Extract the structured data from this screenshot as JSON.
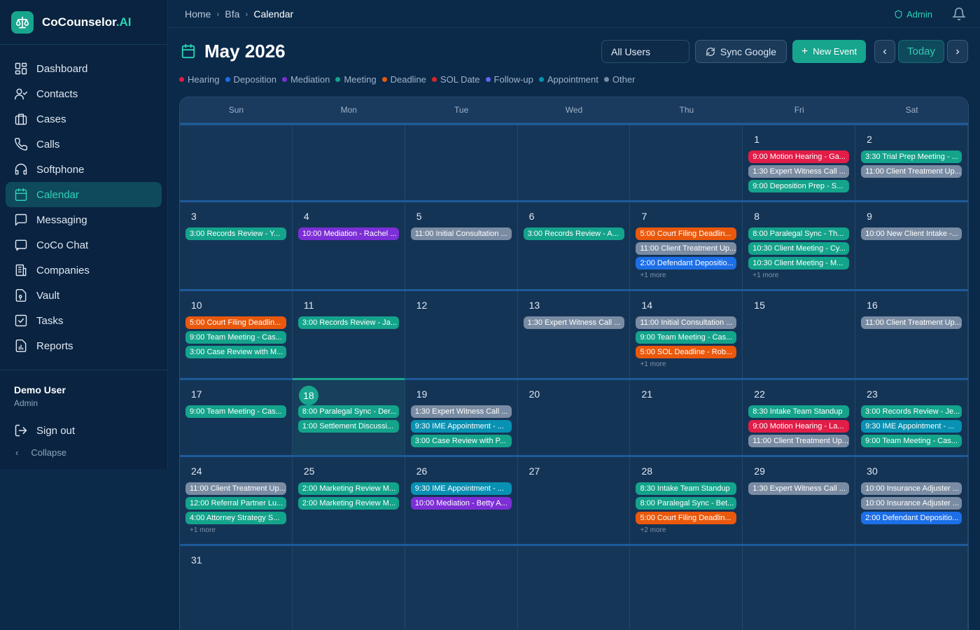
{
  "brand": {
    "name": "CoCounselor",
    "suffix": ".AI"
  },
  "nav": [
    {
      "label": "Dashboard",
      "icon": "dashboard-icon"
    },
    {
      "label": "Contacts",
      "icon": "contacts-icon"
    },
    {
      "label": "Cases",
      "icon": "briefcase-icon"
    },
    {
      "label": "Calls",
      "icon": "phone-icon"
    },
    {
      "label": "Softphone",
      "icon": "headset-icon"
    },
    {
      "label": "Calendar",
      "icon": "calendar-icon",
      "active": true
    },
    {
      "label": "Messaging",
      "icon": "message-icon"
    },
    {
      "label": "CoCo Chat",
      "icon": "chat-icon"
    },
    {
      "label": "Companies",
      "icon": "building-icon"
    },
    {
      "label": "Vault",
      "icon": "vault-icon"
    },
    {
      "label": "Tasks",
      "icon": "checkbox-icon"
    },
    {
      "label": "Reports",
      "icon": "report-icon"
    }
  ],
  "user": {
    "name": "Demo User",
    "role": "Admin"
  },
  "sidebar_footer": {
    "signout": "Sign out",
    "collapse": "Collapse"
  },
  "breadcrumb": [
    "Home",
    "Bfa",
    "Calendar"
  ],
  "topbar": {
    "admin": "Admin"
  },
  "header": {
    "title": "May 2026",
    "users_select": "All Users",
    "sync": "Sync Google",
    "new_event": "New Event",
    "today": "Today"
  },
  "colors": {
    "hearing": "#e11d48",
    "deposition": "#1d6fe8",
    "mediation": "#7c2fd6",
    "meeting": "#14a38b",
    "deadline": "#ea580c",
    "sol": "#dc2626",
    "followup": "#6366f1",
    "appointment": "#0891b2",
    "other": "#7a8ca3"
  },
  "legend": [
    {
      "label": "Hearing",
      "type": "hearing"
    },
    {
      "label": "Deposition",
      "type": "deposition"
    },
    {
      "label": "Mediation",
      "type": "mediation"
    },
    {
      "label": "Meeting",
      "type": "meeting"
    },
    {
      "label": "Deadline",
      "type": "deadline"
    },
    {
      "label": "SOL Date",
      "type": "sol"
    },
    {
      "label": "Follow-up",
      "type": "followup"
    },
    {
      "label": "Appointment",
      "type": "appointment"
    },
    {
      "label": "Other",
      "type": "other"
    }
  ],
  "weekdays": [
    "Sun",
    "Mon",
    "Tue",
    "Wed",
    "Thu",
    "Fri",
    "Sat"
  ],
  "today": 18,
  "weeks": [
    [
      null,
      null,
      null,
      null,
      null,
      {
        "day": 1,
        "events": [
          {
            "text": "9:00 Motion Hearing - Ga...",
            "type": "hearing"
          },
          {
            "text": "1:30 Expert Witness Call ...",
            "type": "other"
          },
          {
            "text": "9:00 Deposition Prep - S...",
            "type": "meeting"
          }
        ]
      },
      {
        "day": 2,
        "events": [
          {
            "text": "3:30 Trial Prep Meeting - ...",
            "type": "meeting"
          },
          {
            "text": "11:00 Client Treatment Up...",
            "type": "other"
          }
        ]
      }
    ],
    [
      {
        "day": 3,
        "events": [
          {
            "text": "3:00 Records Review - Y...",
            "type": "meeting"
          }
        ]
      },
      {
        "day": 4,
        "events": [
          {
            "text": "10:00 Mediation - Rachel ...",
            "type": "mediation"
          }
        ]
      },
      {
        "day": 5,
        "events": [
          {
            "text": "11:00 Initial Consultation ...",
            "type": "other"
          }
        ]
      },
      {
        "day": 6,
        "events": [
          {
            "text": "3:00 Records Review - A...",
            "type": "meeting"
          }
        ]
      },
      {
        "day": 7,
        "events": [
          {
            "text": "5:00 Court Filing Deadlin...",
            "type": "deadline"
          },
          {
            "text": "11:00 Client Treatment Up...",
            "type": "other"
          },
          {
            "text": "2:00 Defendant Depositio...",
            "type": "deposition"
          }
        ],
        "more": "+1 more"
      },
      {
        "day": 8,
        "events": [
          {
            "text": "8:00 Paralegal Sync - Th...",
            "type": "meeting"
          },
          {
            "text": "10:30 Client Meeting - Cy...",
            "type": "meeting"
          },
          {
            "text": "10:30 Client Meeting - M...",
            "type": "meeting"
          }
        ],
        "more": "+1 more"
      },
      {
        "day": 9,
        "events": [
          {
            "text": "10:00 New Client Intake -...",
            "type": "other"
          }
        ]
      }
    ],
    [
      {
        "day": 10,
        "events": [
          {
            "text": "5:00 Court Filing Deadlin...",
            "type": "deadline"
          },
          {
            "text": "9:00 Team Meeting - Cas...",
            "type": "meeting"
          },
          {
            "text": "3:00 Case Review with M...",
            "type": "meeting"
          }
        ]
      },
      {
        "day": 11,
        "events": [
          {
            "text": "3:00 Records Review - Ja...",
            "type": "meeting"
          }
        ]
      },
      {
        "day": 12,
        "events": []
      },
      {
        "day": 13,
        "events": [
          {
            "text": "1:30 Expert Witness Call ...",
            "type": "other"
          }
        ]
      },
      {
        "day": 14,
        "events": [
          {
            "text": "11:00 Initial Consultation ...",
            "type": "other"
          },
          {
            "text": "9:00 Team Meeting - Cas...",
            "type": "meeting"
          },
          {
            "text": "5:00 SOL Deadline - Rob...",
            "type": "deadline"
          }
        ],
        "more": "+1 more"
      },
      {
        "day": 15,
        "events": []
      },
      {
        "day": 16,
        "events": [
          {
            "text": "11:00 Client Treatment Up...",
            "type": "other"
          }
        ]
      }
    ],
    [
      {
        "day": 17,
        "events": [
          {
            "text": "9:00 Team Meeting - Cas...",
            "type": "meeting"
          }
        ]
      },
      {
        "day": 18,
        "events": [
          {
            "text": "8:00 Paralegal Sync - Der...",
            "type": "meeting"
          },
          {
            "text": "1:00 Settlement Discussi...",
            "type": "meeting"
          }
        ]
      },
      {
        "day": 19,
        "events": [
          {
            "text": "1:30 Expert Witness Call ...",
            "type": "other"
          },
          {
            "text": "9:30 IME Appointment - ...",
            "type": "appointment"
          },
          {
            "text": "3:00 Case Review with P...",
            "type": "meeting"
          }
        ]
      },
      {
        "day": 20,
        "events": []
      },
      {
        "day": 21,
        "events": []
      },
      {
        "day": 22,
        "events": [
          {
            "text": "8:30 Intake Team Standup",
            "type": "meeting"
          },
          {
            "text": "9:00 Motion Hearing - La...",
            "type": "hearing"
          },
          {
            "text": "11:00 Client Treatment Up...",
            "type": "other"
          }
        ]
      },
      {
        "day": 23,
        "events": [
          {
            "text": "3:00 Records Review - Je...",
            "type": "meeting"
          },
          {
            "text": "9:30 IME Appointment - ...",
            "type": "appointment"
          },
          {
            "text": "9:00 Team Meeting - Cas...",
            "type": "meeting"
          }
        ]
      }
    ],
    [
      {
        "day": 24,
        "events": [
          {
            "text": "11:00 Client Treatment Up...",
            "type": "other"
          },
          {
            "text": "12:00 Referral Partner Lu...",
            "type": "meeting"
          },
          {
            "text": "4:00 Attorney Strategy S...",
            "type": "meeting"
          }
        ],
        "more": "+1 more"
      },
      {
        "day": 25,
        "events": [
          {
            "text": "2:00 Marketing Review M...",
            "type": "meeting"
          },
          {
            "text": "2:00 Marketing Review M...",
            "type": "meeting"
          }
        ]
      },
      {
        "day": 26,
        "events": [
          {
            "text": "9:30 IME Appointment - ...",
            "type": "appointment"
          },
          {
            "text": "10:00 Mediation - Betty A...",
            "type": "mediation"
          }
        ]
      },
      {
        "day": 27,
        "events": []
      },
      {
        "day": 28,
        "events": [
          {
            "text": "8:30 Intake Team Standup",
            "type": "meeting"
          },
          {
            "text": "8:00 Paralegal Sync - Bet...",
            "type": "meeting"
          },
          {
            "text": "5:00 Court Filing Deadlin...",
            "type": "deadline"
          }
        ],
        "more": "+2 more"
      },
      {
        "day": 29,
        "events": [
          {
            "text": "1:30 Expert Witness Call ...",
            "type": "other"
          }
        ]
      },
      {
        "day": 30,
        "events": [
          {
            "text": "10:00 Insurance Adjuster ...",
            "type": "other"
          },
          {
            "text": "10:00 Insurance Adjuster ...",
            "type": "other"
          },
          {
            "text": "2:00 Defendant Depositio...",
            "type": "deposition"
          }
        ]
      }
    ],
    [
      {
        "day": 31,
        "events": []
      },
      null,
      null,
      null,
      null,
      null,
      null
    ]
  ]
}
